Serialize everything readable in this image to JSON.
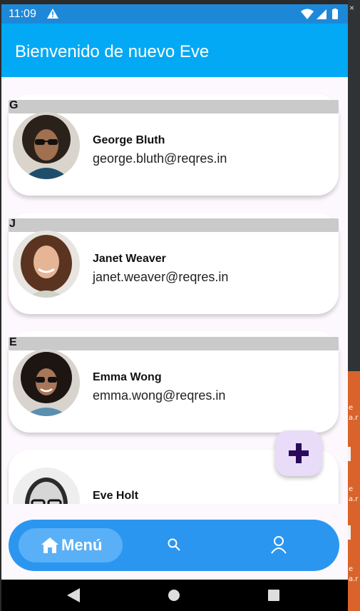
{
  "status_bar": {
    "time": "11:09"
  },
  "app_bar": {
    "title": "Bienvenido de nuevo Eve"
  },
  "users": [
    {
      "letter": "G",
      "name": "George Bluth",
      "email": "george.bluth@reqres.in"
    },
    {
      "letter": "J",
      "name": "Janet Weaver",
      "email": "janet.weaver@reqres.in"
    },
    {
      "letter": "E",
      "name": "Emma Wong",
      "email": "emma.wong@reqres.in"
    },
    {
      "letter": "",
      "name": "Eve Holt",
      "email": ""
    }
  ],
  "bottom_nav": {
    "items": [
      {
        "label": "Menú",
        "icon": "home-icon"
      },
      {
        "label": "",
        "icon": "search-icon"
      },
      {
        "label": "",
        "icon": "profile-icon"
      }
    ]
  },
  "fab": {
    "icon": "plus-icon"
  },
  "colors": {
    "app_bar": "#03a9f4",
    "status_bar": "#1e88d8",
    "bottom_nav": "#2b96f0",
    "fab": "#e9dcf8",
    "fab_icon": "#2c0a5a"
  },
  "side_fragments": [
    "e",
    "a.r",
    "e",
    "a.r",
    "e",
    "a.r"
  ]
}
